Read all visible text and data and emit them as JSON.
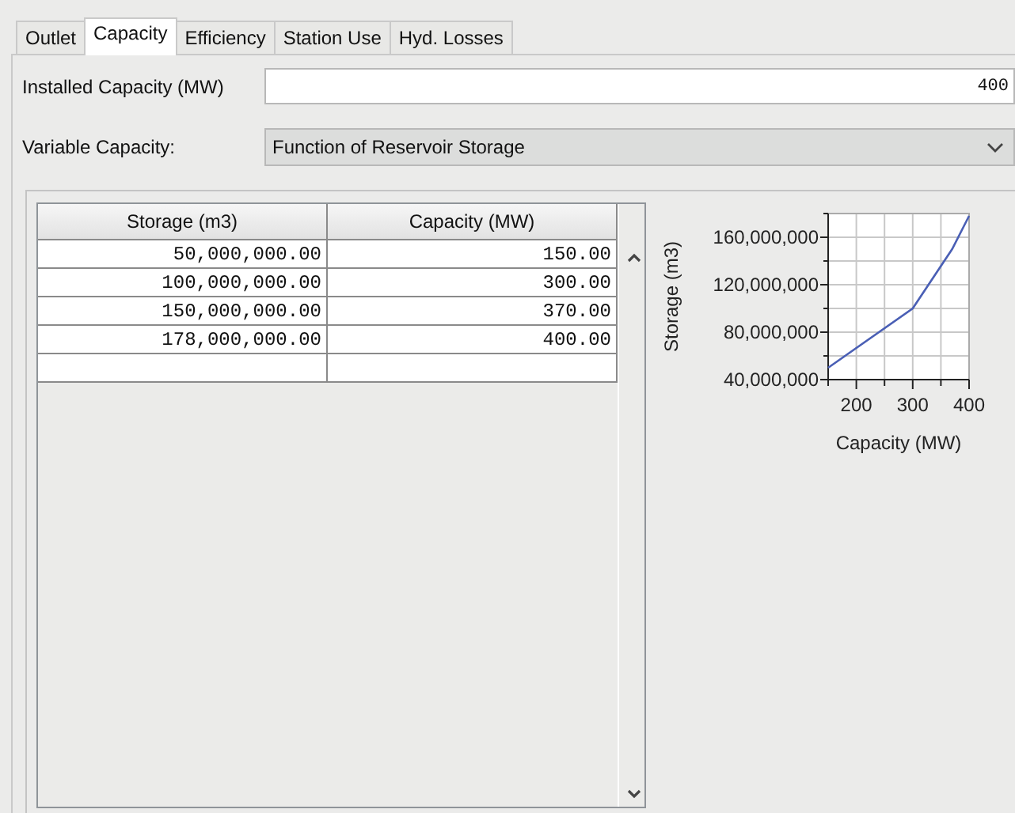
{
  "tabs": [
    {
      "label": "Outlet",
      "selected": false
    },
    {
      "label": "Capacity",
      "selected": true
    },
    {
      "label": "Efficiency",
      "selected": false
    },
    {
      "label": "Station Use",
      "selected": false
    },
    {
      "label": "Hyd. Losses",
      "selected": false
    }
  ],
  "installed_capacity": {
    "label": "Installed Capacity (MW)",
    "value": "400"
  },
  "variable_capacity": {
    "label": "Variable Capacity:",
    "value": "Function of Reservoir Storage"
  },
  "table": {
    "columns": [
      "Storage (m3)",
      "Capacity (MW)"
    ],
    "rows": [
      [
        "50,000,000.00",
        "150.00"
      ],
      [
        "100,000,000.00",
        "300.00"
      ],
      [
        "150,000,000.00",
        "370.00"
      ],
      [
        "178,000,000.00",
        "400.00"
      ]
    ]
  },
  "chart": {
    "chart_data": {
      "type": "line",
      "xlabel": "Capacity (MW)",
      "ylabel": "Storage (m3)",
      "x": [
        150,
        300,
        370,
        400
      ],
      "grid": true,
      "series": [
        {
          "color": "#4a5fb5",
          "values": [
            50000000,
            100000000,
            150000000,
            178000000
          ]
        }
      ],
      "xlim": [
        150,
        400
      ],
      "ylim": [
        40000000,
        180000000
      ],
      "xticks": [
        200,
        300,
        400
      ],
      "yticks": [
        {
          "value": 40000000,
          "label": "40,000,000"
        },
        {
          "value": 80000000,
          "label": "80,000,000"
        },
        {
          "value": 120000000,
          "label": "120,000,000"
        },
        {
          "value": 160000000,
          "label": "160,000,000"
        }
      ]
    }
  }
}
